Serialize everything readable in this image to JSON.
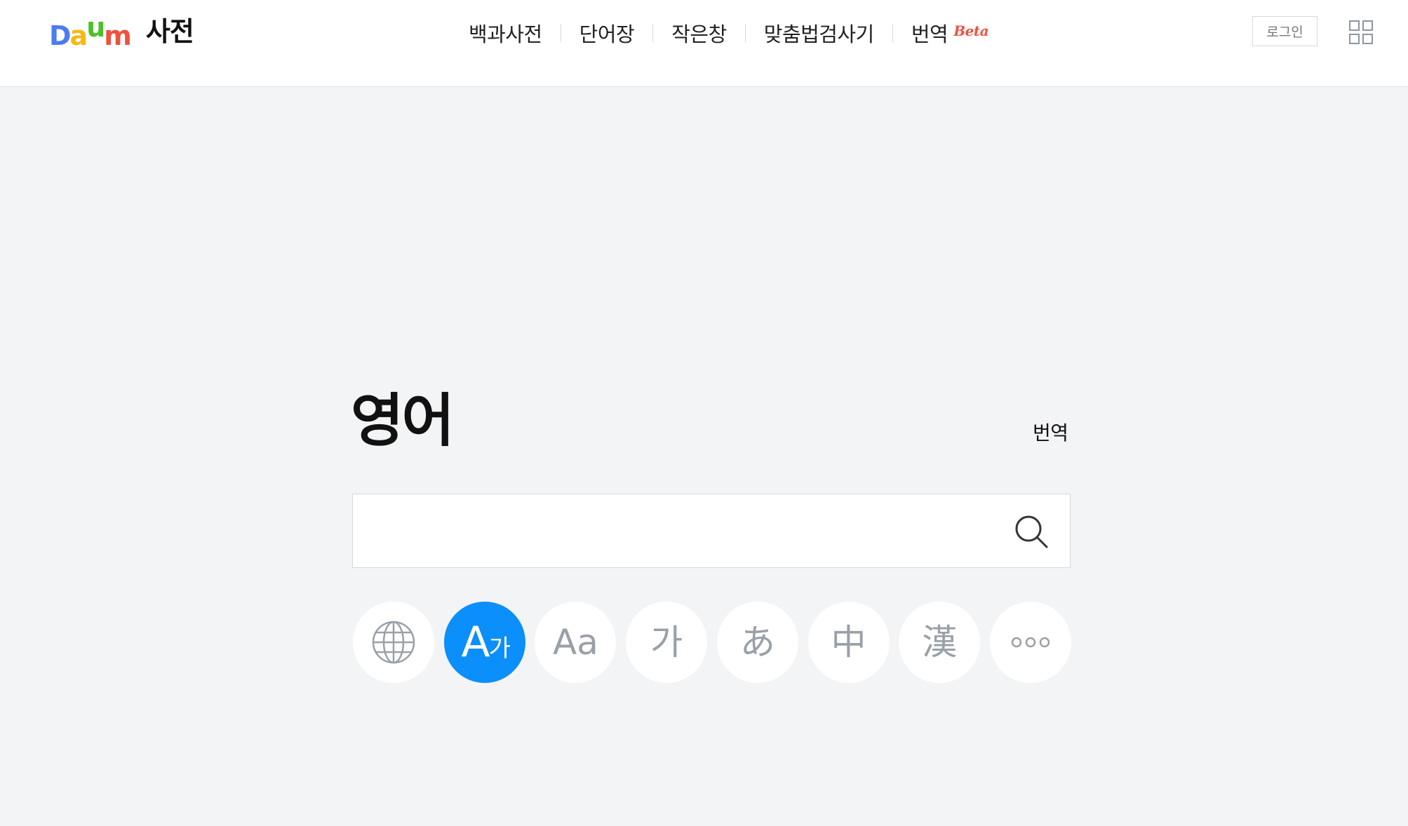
{
  "header": {
    "logo": {
      "letters": [
        {
          "char": "D",
          "color": "#4b7bf5"
        },
        {
          "char": "a",
          "color": "#f3b914"
        },
        {
          "char": "u",
          "color": "#4ec02b"
        },
        {
          "char": "m",
          "color": "#f0513f"
        }
      ],
      "service_name": "사전"
    },
    "nav": [
      {
        "label": "백과사전"
      },
      {
        "label": "단어장"
      },
      {
        "label": "작은창"
      },
      {
        "label": "맞춤법검사기"
      },
      {
        "label": "번역",
        "badge": "Beta"
      }
    ],
    "login_label": "로그인",
    "apps_icon": "grid-icon"
  },
  "main": {
    "title": "영어",
    "translate_link": "번역",
    "search": {
      "value": "",
      "placeholder": "",
      "icon": "search-icon"
    },
    "languages": [
      {
        "name": "globe",
        "icon": "globe-icon",
        "active": false
      },
      {
        "name": "english-korean",
        "label_big": "A",
        "label_small": "가",
        "active": true
      },
      {
        "name": "english",
        "label": "Aa",
        "active": false
      },
      {
        "name": "korean",
        "label": "가",
        "active": false
      },
      {
        "name": "japanese",
        "label": "あ",
        "active": false
      },
      {
        "name": "chinese",
        "label": "中",
        "active": false
      },
      {
        "name": "hanja",
        "label": "漢",
        "active": false
      },
      {
        "name": "more",
        "icon": "more-icon",
        "active": false
      }
    ]
  },
  "colors": {
    "accent": "#0b8ffa",
    "beta": "#f0513f",
    "background": "#f3f4f6",
    "inactive_icon": "#9aa0a8"
  }
}
